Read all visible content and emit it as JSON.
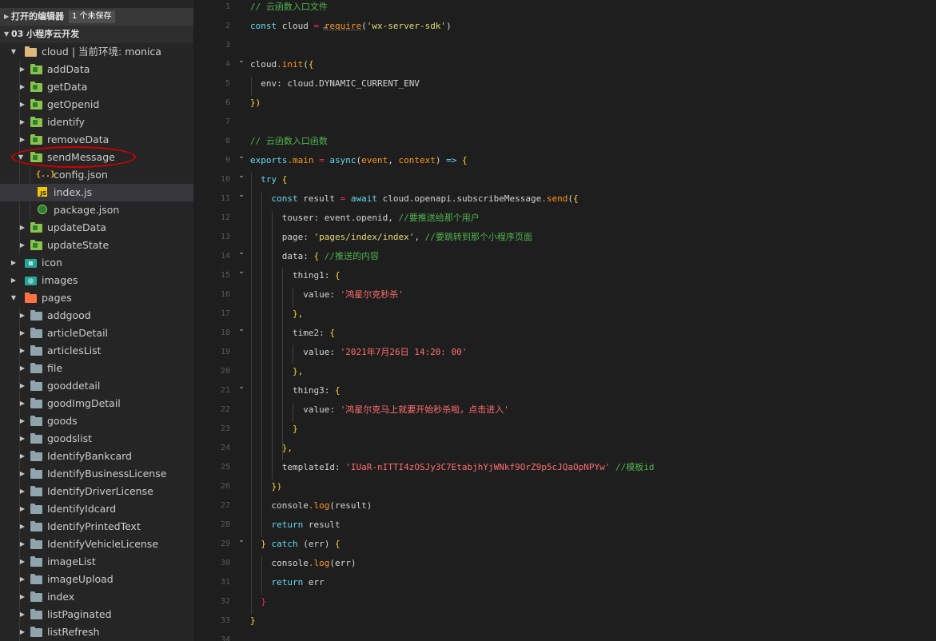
{
  "sidebar": {
    "open_editors_label": "打开的编辑器",
    "unsaved_badge": "1 个未保存",
    "workspace_label": "03 小程序云开发",
    "tree": [
      {
        "label": "cloud | 当前环境: monica",
        "icon": "folder-open-icon"
      },
      {
        "label": "addData",
        "icon": "cloud-function-folder-icon"
      },
      {
        "label": "getData",
        "icon": "cloud-function-folder-icon"
      },
      {
        "label": "getOpenid",
        "icon": "cloud-function-folder-icon"
      },
      {
        "label": "identify",
        "icon": "cloud-function-folder-icon"
      },
      {
        "label": "removeData",
        "icon": "cloud-function-folder-icon"
      },
      {
        "label": "sendMessage",
        "icon": "cloud-function-folder-icon"
      },
      {
        "label": "config.json",
        "icon": "json-file-icon"
      },
      {
        "label": "index.js",
        "icon": "js-file-icon"
      },
      {
        "label": "package.json",
        "icon": "package-json-icon"
      },
      {
        "label": "updateData",
        "icon": "cloud-function-folder-icon"
      },
      {
        "label": "updateState",
        "icon": "cloud-function-folder-icon"
      },
      {
        "label": "icon",
        "icon": "icon-folder-icon"
      },
      {
        "label": "images",
        "icon": "images-folder-icon"
      },
      {
        "label": "pages",
        "icon": "pages-folder-icon"
      },
      {
        "label": "addgood",
        "icon": "folder-icon"
      },
      {
        "label": "articleDetail",
        "icon": "folder-icon"
      },
      {
        "label": "articlesList",
        "icon": "folder-icon"
      },
      {
        "label": "file",
        "icon": "folder-icon"
      },
      {
        "label": "gooddetail",
        "icon": "folder-icon"
      },
      {
        "label": "goodImgDetail",
        "icon": "folder-icon"
      },
      {
        "label": "goods",
        "icon": "folder-icon"
      },
      {
        "label": "goodslist",
        "icon": "folder-icon"
      },
      {
        "label": "IdentifyBankcard",
        "icon": "folder-icon"
      },
      {
        "label": "IdentifyBusinessLicense",
        "icon": "folder-icon"
      },
      {
        "label": "IdentifyDriverLicense",
        "icon": "folder-icon"
      },
      {
        "label": "IdentifyIdcard",
        "icon": "folder-icon"
      },
      {
        "label": "IdentifyPrintedText",
        "icon": "folder-icon"
      },
      {
        "label": "IdentifyVehicleLicense",
        "icon": "folder-icon"
      },
      {
        "label": "imageList",
        "icon": "folder-icon"
      },
      {
        "label": "imageUpload",
        "icon": "folder-icon"
      },
      {
        "label": "index",
        "icon": "folder-icon"
      },
      {
        "label": "listPaginated",
        "icon": "folder-icon"
      },
      {
        "label": "listRefresh",
        "icon": "folder-icon"
      }
    ],
    "selected_file": "index.js"
  },
  "editor": {
    "line_numbers": [
      "1",
      "2",
      "3",
      "4",
      "5",
      "6",
      "7",
      "8",
      "9",
      "10",
      "11",
      "12",
      "13",
      "14",
      "15",
      "16",
      "17",
      "18",
      "19",
      "20",
      "21",
      "22",
      "23",
      "24",
      "25",
      "26",
      "27",
      "28",
      "29",
      "30",
      "31",
      "32",
      "33",
      "34"
    ],
    "code": {
      "l1_comment": "// 云函数入口文件",
      "l2_const": "const",
      "l2_cloud": " cloud ",
      "l2_eq": "=",
      "l2_require": "require",
      "l2_arg": "'wx-server-sdk'",
      "l4_cloud": "cloud",
      "l4_init": ".init",
      "l5_env": "env",
      "l5_value": ": cloud.DYNAMIC_CURRENT_ENV",
      "l6_close": "})",
      "l8_comment": "// 云函数入口函数",
      "l9_exports": "exports",
      "l9_main": ".main",
      "l9_eq": " = ",
      "l9_async": "async",
      "l9_event": "event",
      "l9_context": "context",
      "l9_arrow": "=>",
      "l10_try": "try",
      "l11_const": "const",
      "l11_result": " result ",
      "l11_eq": "=",
      "l11_await": "await",
      "l11_chain": " cloud.openapi.subscribeMessage",
      "l11_send": ".send",
      "l12_touser": "touser: event.openid, ",
      "l12_comment": "//要推送给那个用户",
      "l13_page": "page: ",
      "l13_value": "'pages/index/index'",
      "l13_comment": "//要跳转到那个小程序页面",
      "l14_data": "data: ",
      "l14_comment": "//推送的内容",
      "l15_thing1": "thing1: ",
      "l16_value_key": "value: ",
      "l16_value": "'鸿星尔克秒杀'",
      "l17_close": "},",
      "l18_time2": "time2: ",
      "l19_value_key": "value: ",
      "l19_value": "'2021年7月26日 14:20: 00'",
      "l20_close": "},",
      "l21_thing3": "thing3: ",
      "l22_value_key": "value: ",
      "l22_value": "'鸿星尔克马上就要开始秒杀啦，点击进入'",
      "l23_close": "}",
      "l24_close": "},",
      "l25_tid": "templateId: ",
      "l25_value": "'IUaR-nITTI4zOSJy3C7EtabjhYjWNkf9OrZ9p5cJQaOpNPYw'",
      "l25_comment": " //模板id",
      "l26_close": "})",
      "l27_console": "console",
      "l27_log": ".log",
      "l27_arg": "(result)",
      "l28_return": "return",
      "l28_val": " result",
      "l29_close": "} ",
      "l29_catch": "catch",
      "l29_rest": " (err) ",
      "l30_console": "console",
      "l30_log": ".log",
      "l30_arg": "(err)",
      "l31_return": "return",
      "l31_val": " err",
      "l32_close": "}",
      "l33_close": "}"
    }
  },
  "colors": {
    "keyword": "#f92672",
    "function": "#fd971f",
    "string": "#e6db74",
    "string_cn": "#ff6e6e",
    "comment": "#4fb34f",
    "property": "#66d9ef",
    "annotation": "#d00000"
  }
}
